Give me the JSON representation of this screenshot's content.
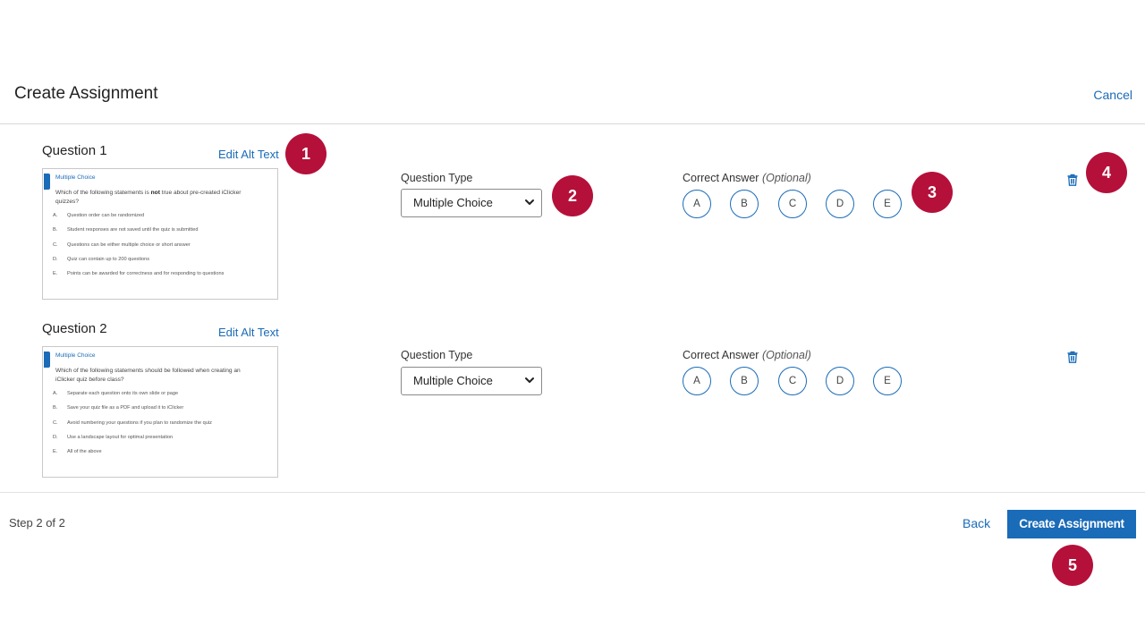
{
  "header": {
    "title": "Create Assignment",
    "cancel_label": "Cancel"
  },
  "questions": [
    {
      "title": "Question 1",
      "edit_alt_label": "Edit Alt Text",
      "thumbnail": {
        "type_label": "Multiple Choice",
        "question_pre": "Which of the following statements is ",
        "question_bold": "not",
        "question_post": " true about pre-created iClicker quizzes?",
        "options": [
          {
            "letter": "A.",
            "text": "Question order can be randomized"
          },
          {
            "letter": "B.",
            "text": "Student responses are not saved until the quiz is submitted"
          },
          {
            "letter": "C.",
            "text": "Questions can be either multiple choice or short answer"
          },
          {
            "letter": "D.",
            "text": "Quiz can contain up to 200 questions"
          },
          {
            "letter": "E.",
            "text": "Points can be awarded for correctness and for responding to questions"
          }
        ]
      },
      "question_type_label": "Question Type",
      "question_type_value": "Multiple Choice",
      "correct_answer_label": "Correct Answer",
      "optional_label": "(Optional)",
      "answers": [
        "A",
        "B",
        "C",
        "D",
        "E"
      ]
    },
    {
      "title": "Question 2",
      "edit_alt_label": "Edit Alt Text",
      "thumbnail": {
        "type_label": "Multiple Choice",
        "question_pre": "Which of the following statements should be followed when creating an iClicker quiz before class?",
        "question_bold": "",
        "question_post": "",
        "options": [
          {
            "letter": "A.",
            "text": "Separate each question onto its own slide or page"
          },
          {
            "letter": "B.",
            "text": "Save your quiz file as a PDF and upload it to iClicker"
          },
          {
            "letter": "C.",
            "text": "Avoid numbering your questions if you plan to randomize the quiz"
          },
          {
            "letter": "D.",
            "text": "Use a landscape layout for optimal presentation"
          },
          {
            "letter": "E.",
            "text": "All of the above"
          }
        ]
      },
      "question_type_label": "Question Type",
      "question_type_value": "Multiple Choice",
      "correct_answer_label": "Correct Answer",
      "optional_label": "(Optional)",
      "answers": [
        "A",
        "B",
        "C",
        "D",
        "E"
      ]
    }
  ],
  "callouts": [
    "1",
    "2",
    "3",
    "4",
    "5"
  ],
  "footer": {
    "step_text": "Step 2 of 2",
    "back_label": "Back",
    "create_label": "Create Assignment"
  },
  "colors": {
    "accent": "#1a6bb8",
    "callout": "#b5103a"
  },
  "icons": {
    "delete": "trash-icon",
    "dropdown": "chevron-down-icon"
  }
}
